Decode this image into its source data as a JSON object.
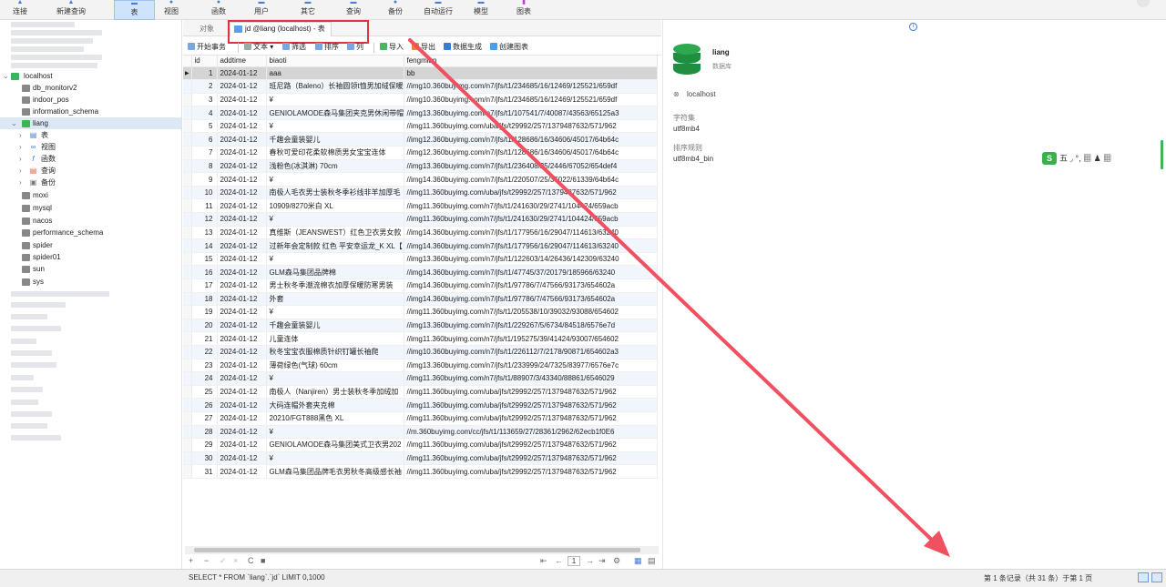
{
  "ribbon": {
    "buttons": [
      {
        "label": "连接",
        "icon": "connect-icon"
      },
      {
        "label": "新建查询",
        "icon": "new-query-icon"
      },
      {
        "label": "表",
        "icon": "table-icon",
        "active": true
      },
      {
        "label": "视图",
        "icon": "view-icon"
      },
      {
        "label": "函数",
        "icon": "function-icon"
      },
      {
        "label": "用户",
        "icon": "user-icon"
      },
      {
        "label": "其它",
        "icon": "other-icon"
      },
      {
        "label": "查询",
        "icon": "query-icon"
      },
      {
        "label": "备份",
        "icon": "backup-icon"
      },
      {
        "label": "自动运行",
        "icon": "automation-icon"
      },
      {
        "label": "模型",
        "icon": "model-icon"
      },
      {
        "label": "图表",
        "icon": "chart-icon"
      }
    ]
  },
  "tree": {
    "connection": "localhost",
    "databases_before": [
      "db_monitorv2",
      "indoor_pos",
      "information_schema"
    ],
    "selected_db": "liang",
    "children": [
      "表",
      "视图",
      "函数",
      "查询",
      "备份"
    ],
    "databases_after": [
      "moxi",
      "mysql",
      "nacos",
      "performance_schema",
      "spider",
      "spider01",
      "sun",
      "sys"
    ]
  },
  "tabs": {
    "objects": "对象",
    "active": "jd @liang (localhost) - 表"
  },
  "toolbar": {
    "begin_transaction": "开始事务",
    "text": "文本",
    "filter": "筛选",
    "sort": "排序",
    "columns": "列",
    "import": "导入",
    "export": "导出",
    "data_gen": "数据生成",
    "create_chart": "创建图表"
  },
  "grid": {
    "columns": [
      "id",
      "addtime",
      "biaoti",
      "fengmian"
    ],
    "rows": [
      [
        "1",
        "2024-01-12",
        "aaa",
        "bb"
      ],
      [
        "2",
        "2024-01-12",
        "班尼路（Baleno）长袖圆领t恤男加绒保暖",
        "//img10.360buyimg.com/n7/jfs/t1/234685/16/12469/125521/659df"
      ],
      [
        "3",
        "2024-01-12",
        "¥",
        "//img10.360buyimg.com/n7/jfs/t1/234685/16/12469/125521/659df"
      ],
      [
        "4",
        "2024-01-12",
        "GENIOLAMODE森马集团夹克男休闲带帽",
        "//img13.360buyimg.com/n7/jfs/t1/107541/7/40087/43563/65125a3"
      ],
      [
        "5",
        "2024-01-12",
        "¥",
        "//img11.360buyimg.com/uba/jfs/t29992/257/1379487632/571/962"
      ],
      [
        "6",
        "2024-01-12",
        "千趣会童装婴儿",
        "//img12.360buyimg.com/n7/jfs/t1/128686/16/34606/45017/64b64c"
      ],
      [
        "7",
        "2024-01-12",
        "春秋可爱印花柔软棉质男女宝宝连体",
        "//img12.360buyimg.com/n7/jfs/t1/128686/16/34606/45017/64b64c"
      ],
      [
        "8",
        "2024-01-12",
        "浅粉色(冰淇淋) 70cm",
        "//img13.360buyimg.com/n7/jfs/t1/236408/25/2446/67052/654def4"
      ],
      [
        "9",
        "2024-01-12",
        "¥",
        "//img14.360buyimg.com/n7/jfs/t1/220507/25/35022/61339/64b64c"
      ],
      [
        "10",
        "2024-01-12",
        "南极人毛衣男士装秋冬季衫线非羊加厚毛",
        "//img11.360buyimg.com/uba/jfs/t29992/257/1379487632/571/962"
      ],
      [
        "11",
        "2024-01-12",
        "10909/8270米白 XL",
        "//img11.360buyimg.com/n7/jfs/t1/241630/29/2741/104424/659acb"
      ],
      [
        "12",
        "2024-01-12",
        "¥",
        "//img11.360buyimg.com/n7/jfs/t1/241630/29/2741/104424/659acb"
      ],
      [
        "13",
        "2024-01-12",
        "真维斯（JEANSWEST）红色卫衣男女款",
        "//img14.360buyimg.com/n7/jfs/t1/177956/16/29047/114613/63240"
      ],
      [
        "14",
        "2024-01-12",
        "过新年会定制款 红色 平安幸运龙_K XL【",
        "//img14.360buyimg.com/n7/jfs/t1/177956/16/29047/114613/63240"
      ],
      [
        "15",
        "2024-01-12",
        "¥",
        "//img13.360buyimg.com/n7/jfs/t1/122603/14/26436/142309/63240"
      ],
      [
        "16",
        "2024-01-12",
        "GLM森马集团品牌棉",
        "//img14.360buyimg.com/n7/jfs/t1/47745/37/20179/185966/63240"
      ],
      [
        "17",
        "2024-01-12",
        "男士秋冬季潮流棉衣加厚保暖防寒男装",
        "//img14.360buyimg.com/n7/jfs/t1/97786/7/47566/93173/654602a"
      ],
      [
        "18",
        "2024-01-12",
        "外套",
        "//img14.360buyimg.com/n7/jfs/t1/97786/7/47566/93173/654602a"
      ],
      [
        "19",
        "2024-01-12",
        "¥",
        "//img11.360buyimg.com/n7/jfs/t1/205538/10/39032/93088/654602"
      ],
      [
        "20",
        "2024-01-12",
        "千趣会童装婴儿",
        "//img13.360buyimg.com/n7/jfs/t1/229267/5/6734/84518/6576e7d"
      ],
      [
        "21",
        "2024-01-12",
        "儿童连体",
        "//img11.360buyimg.com/n7/jfs/t1/195275/39/41424/93007/654602"
      ],
      [
        "22",
        "2024-01-12",
        "秋冬宝宝衣服棉质针织钉罐长袖爬",
        "//img10.360buyimg.com/n7/jfs/t1/226112/7/2178/90871/654602a3"
      ],
      [
        "23",
        "2024-01-12",
        "薄荷绿色(气球) 60cm",
        "//img13.360buyimg.com/n7/jfs/t1/233999/24/7325/83977/6576e7c"
      ],
      [
        "24",
        "2024-01-12",
        "¥",
        "//img11.360buyimg.com/n7/jfs/t1/88907/3/43340/88861/6546029"
      ],
      [
        "25",
        "2024-01-12",
        "南极人（Nanjiren）男士装秋冬季加绒加",
        "//img11.360buyimg.com/uba/jfs/t29992/257/1379487632/571/962"
      ],
      [
        "26",
        "2024-01-12",
        "大码连帽外套夹克棉",
        "//img11.360buyimg.com/uba/jfs/t29992/257/1379487632/571/962"
      ],
      [
        "27",
        "2024-01-12",
        "20210/FGT888黑色 XL",
        "//img11.360buyimg.com/uba/jfs/t29992/257/1379487632/571/962"
      ],
      [
        "28",
        "2024-01-12",
        "¥",
        "//m.360buyimg.com/cc/jfs/t1/113659/27/28361/2962/62ecb1f0E6"
      ],
      [
        "29",
        "2024-01-12",
        "GENIOLAMODE森马集团美式卫衣男202",
        "//img11.360buyimg.com/uba/jfs/t29992/257/1379487632/571/962"
      ],
      [
        "30",
        "2024-01-12",
        "¥",
        "//img11.360buyimg.com/uba/jfs/t29992/257/1379487632/571/962"
      ],
      [
        "31",
        "2024-01-12",
        "GLM森马集团品牌毛衣男秋冬高级感长袖",
        "//img11.360buyimg.com/uba/jfs/t29992/257/1379487632/571/962"
      ]
    ]
  },
  "pager": {
    "page": "1"
  },
  "right_panel": {
    "db_name": "liang",
    "db_type": "数据库",
    "host": "localhost",
    "charset_label": "字符集",
    "charset_value": "utf8mb4",
    "collation_label": "排序规则",
    "collation_value": "utf8mb4_bin",
    "ime_text": "五 ◞ °, ▦ ♟ ▦"
  },
  "status": {
    "sql": "SELECT * FROM `liang`.`jd` LIMIT 0,1000",
    "records": "第 1 条记录（共 31 条）于第 1 页"
  },
  "colors": {
    "accent": "#3cb45a",
    "annotation": "#e0343c"
  }
}
